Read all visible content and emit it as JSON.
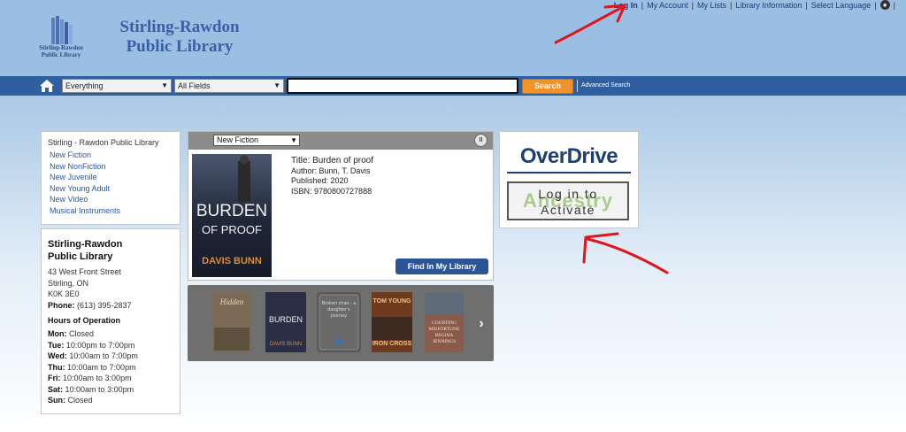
{
  "header": {
    "library_title_line1": "Stirling-Rawdon",
    "library_title_line2": "Public Library",
    "logo_caption_line1": "Stirling-Rawdon",
    "logo_caption_line2": "Public Library",
    "top_links": {
      "login": "Log In",
      "my_account": "My Account",
      "my_lists": "My Lists",
      "library_information": "Library Information",
      "select_language": "Select Language",
      "separator": "|"
    }
  },
  "search": {
    "scope_value": "Everything",
    "field_value": "All Fields",
    "query_value": "",
    "button_label": "Search",
    "advanced_label": "Advanced Search"
  },
  "sidebar": {
    "heading": "Stirling - Rawdon Public Library",
    "links": [
      "New Fiction",
      "New NonFiction",
      "New Juvenile",
      "New Young Adult",
      "New Video",
      "Musical Instruments"
    ]
  },
  "info": {
    "name_line1": "Stirling-Rawdon",
    "name_line2": "Public Library",
    "address1": "43 West Front Street",
    "address2": "Stirling, ON",
    "postal": "K0K 3E0",
    "phone_label": "Phone:",
    "phone": "(613) 395-2837",
    "hours_title": "Hours of Operation",
    "hours": [
      {
        "day": "Mon:",
        "time": "Closed"
      },
      {
        "day": "Tue:",
        "time": "10:00pm to 7:00pm"
      },
      {
        "day": "Wed:",
        "time": "10:00am to 7:00pm"
      },
      {
        "day": "Thu:",
        "time": "10:00am to 7:00pm"
      },
      {
        "day": "Fri:",
        "time": "10:00am to 3:00pm"
      },
      {
        "day": "Sat:",
        "time": "10:00am to 3:00pm"
      },
      {
        "day": "Sun:",
        "time": "Closed"
      }
    ]
  },
  "feature": {
    "list_value": "New Fiction",
    "cover_title_line1": "BURDEN",
    "cover_title_line2": "OF PROOF",
    "cover_author": "DAVIS BUNN",
    "title": "Title: Burden of proof",
    "author": "Author: Bunn, T. Davis",
    "published": "Published: 2020",
    "isbn": "ISBN: 9780800727888",
    "find_button": "Find In My Library"
  },
  "carousel": {
    "thumbs": [
      {
        "line1": "Hidden",
        "line2": "",
        "color": "#7b6a55"
      },
      {
        "line1": "BURDEN",
        "line2": "DAVIS BUNN",
        "color": "#2a2f45"
      },
      {
        "line1": "Broken chair - a daughter's journey",
        "line2": "",
        "color": "#595959"
      },
      {
        "line1": "TOM YOUNG",
        "line2": "IRON CROSS",
        "color": "#6e3a1e"
      },
      {
        "line1": "COURTING MISFORTUNE",
        "line2": "REGINA JENNINGS",
        "color": "#8a5a4a"
      }
    ]
  },
  "overdrive": {
    "logo_text": "OverDrive",
    "watermark": "Ancestry",
    "activate_line1": "Log in to",
    "activate_line2": "Activate"
  },
  "colors": {
    "header_bg": "#9bbfe2",
    "search_bar": "#2f5f9e",
    "search_button": "#f0932b",
    "annotation_red": "#e0161c"
  }
}
